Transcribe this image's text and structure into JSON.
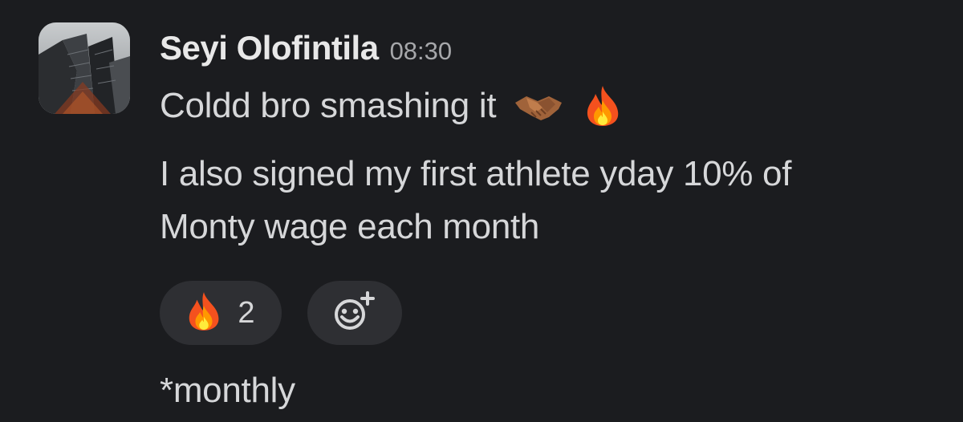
{
  "message": {
    "author": "Seyi Olofintila",
    "timestamp": "08:30",
    "line1_text": "Coldd bro smashing it",
    "line1_emojis": [
      "handshake-emoji",
      "fire-emoji"
    ],
    "line2_text": "I also signed my first athlete yday 10% of",
    "line3_text": "Monty wage each month",
    "followup_text": "*monthly"
  },
  "reactions": [
    {
      "emoji": "fire-emoji",
      "count": "2"
    }
  ],
  "add_reaction_icon": "add-reaction-icon",
  "colors": {
    "background": "#1b1c1f",
    "pill_background": "#2e2f33",
    "text": "#d6d7d9",
    "timestamp": "#a6a7aa"
  }
}
